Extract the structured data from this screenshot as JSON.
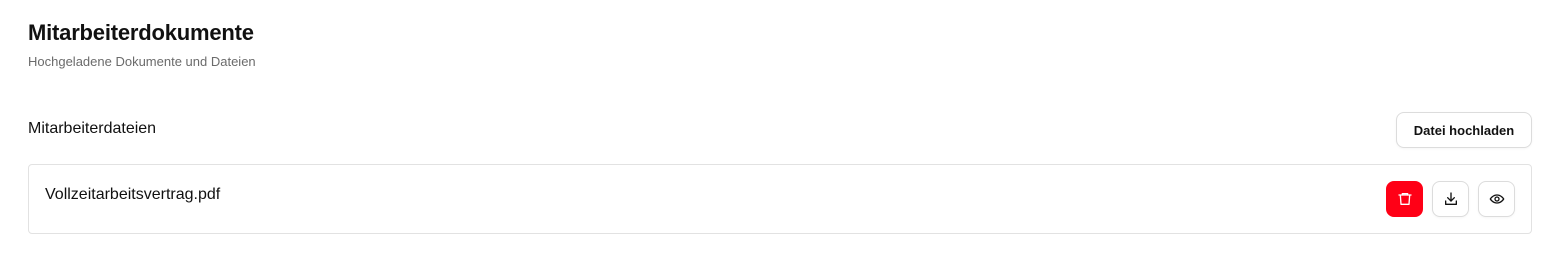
{
  "header": {
    "title": "Mitarbeiterdokumente",
    "subtitle": "Hochgeladene Dokumente und Dateien"
  },
  "files_section": {
    "label": "Mitarbeiterdateien",
    "upload_label": "Datei hochladen",
    "files": [
      {
        "name": "Vollzeitarbeitsvertrag.pdf",
        "actions": [
          {
            "icon": "trash-icon",
            "color": "#ff0016"
          },
          {
            "icon": "download-icon"
          },
          {
            "icon": "eye-icon"
          }
        ]
      }
    ]
  },
  "colors": {
    "delete": "#ff0016",
    "border": "#e2e2e2",
    "subtitle": "#6b6b6b"
  }
}
